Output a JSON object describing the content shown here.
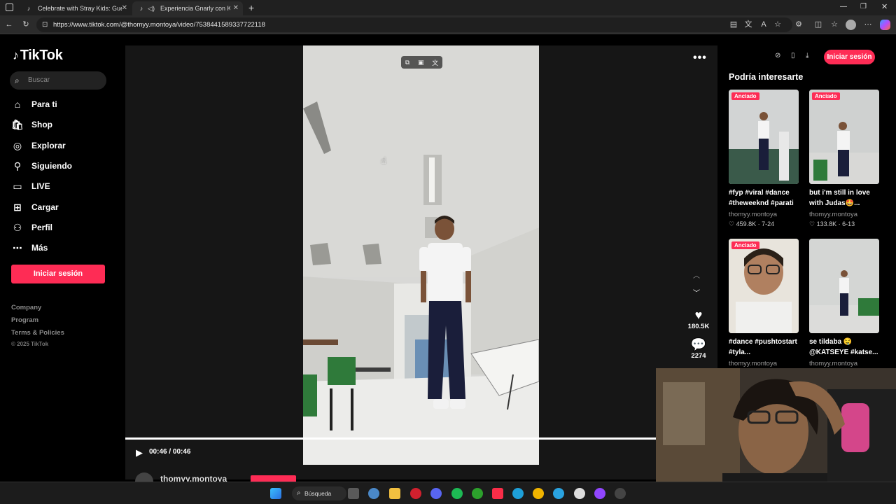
{
  "browser": {
    "tabs": [
      {
        "title": "Celebrate with Stray Kids: Guess t",
        "active": false
      },
      {
        "title": "Experiencia Gnarly con Katse",
        "active": true
      }
    ],
    "new_tab_label": "+",
    "url": "https://www.tiktok.com/@thomyy.montoya/video/7538441589337722118"
  },
  "sidebar": {
    "logo": "TikTok",
    "search_placeholder": "Buscar",
    "nav": [
      {
        "label": "Para ti",
        "icon": "home-icon"
      },
      {
        "label": "Shop",
        "icon": "shop-icon"
      },
      {
        "label": "Explorar",
        "icon": "compass-icon"
      },
      {
        "label": "Siguiendo",
        "icon": "following-icon"
      },
      {
        "label": "LIVE",
        "icon": "live-icon"
      },
      {
        "label": "Cargar",
        "icon": "upload-icon"
      },
      {
        "label": "Perfil",
        "icon": "profile-icon"
      },
      {
        "label": "Más",
        "icon": "more-icon"
      }
    ],
    "login_button": "Iniciar sesión",
    "footer_links": [
      "Company",
      "Program",
      "Terms & Policies"
    ],
    "copyright": "© 2025 TikTok"
  },
  "video": {
    "time": "00:46 / 00:46",
    "progress": 1.0,
    "author": "thomyy.montoya",
    "likes": "180.5K",
    "comments": "2274"
  },
  "right_panel": {
    "login_button": "Iniciar sesión",
    "heading": "Podría interesarte",
    "pinned_label": "Anciado",
    "cards": [
      {
        "title": "#fyp #viral #dance #theweeknd #parati",
        "user": "thomyy.montoya",
        "stats": "♡ 459.8K · 7-24",
        "pinned": true
      },
      {
        "title": "but i'm still in love with Judas🤩...",
        "user": "thomyy.montoya",
        "stats": "♡ 133.8K · 6-13",
        "pinned": true
      },
      {
        "title": "#dance #pushtostart #tyla...",
        "user": "thomyy.montoya",
        "stats": "",
        "pinned": true
      },
      {
        "title": "se tildaba 🤤 @KATSEYE #katse...",
        "user": "thomyy.montoya",
        "stats": "",
        "pinned": false
      }
    ]
  },
  "taskbar": {
    "search_label": "Búsqueda"
  },
  "colors": {
    "accent": "#fe2c55",
    "background": "#000000",
    "video_bg": "#161616"
  }
}
